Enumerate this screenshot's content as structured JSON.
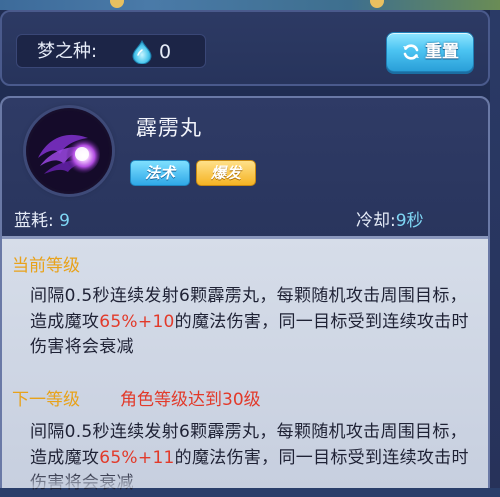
{
  "header": {
    "seed_label": "梦之种:",
    "seed_value": "0",
    "reset_label": "重置"
  },
  "skill": {
    "name": "霹雳丸",
    "tags": [
      "法术",
      "爆发"
    ],
    "mana_label": "蓝耗:",
    "mana_value": "9",
    "cooldown_label": "冷却:",
    "cooldown_value": "9秒"
  },
  "current_level": {
    "title": "当前等级",
    "text_parts": {
      "a": "间隔0.5秒连续发射6颗霹雳丸，每颗随机攻击周围目标，造成魔攻",
      "pct": "65%",
      "plus": "+",
      "flat": "10",
      "b": "的魔法伤害，同一目标受到连续攻击时伤害将会衰减"
    }
  },
  "next_level": {
    "title": "下一等级",
    "requirement": "角色等级达到30级",
    "text_parts": {
      "a": "间隔0.5秒连续发射6颗霹雳丸，每颗随机攻击周围目标，造成魔攻",
      "pct": "65%",
      "plus": "+",
      "flat": "11",
      "b": "的魔法伤害，同一目标受到连续攻击时伤害将会衰减"
    }
  },
  "colors": {
    "accent_gold": "#e8a21a",
    "accent_red": "#e23a2a",
    "stat_blue": "#7fd6f4",
    "tag_spell": "#2fa8e8",
    "tag_burst": "#f5b324"
  },
  "icons": {
    "seed": "water-drop-icon",
    "reset": "refresh-icon",
    "skill": "purple-flame-orb-icon"
  }
}
